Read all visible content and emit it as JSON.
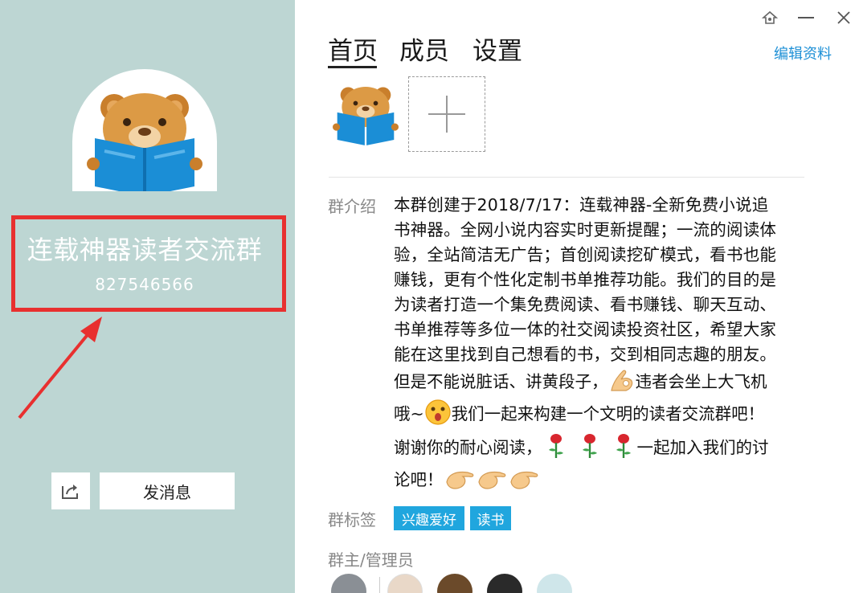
{
  "window_controls": {
    "skin_icon": "skin-icon",
    "minimize_icon": "minimize-icon",
    "close_icon": "close-icon"
  },
  "profile": {
    "group_name": "连载神器读者交流群",
    "group_id": "827546566",
    "avatar_icon": "bear-reading-book"
  },
  "actions": {
    "share_icon": "share-icon",
    "send_message_label": "发消息"
  },
  "tabs": [
    {
      "label": "首页",
      "active": true
    },
    {
      "label": "成员",
      "active": false
    },
    {
      "label": "设置",
      "active": false
    }
  ],
  "edit_profile_label": "编辑资料",
  "album": {
    "add_icon": "plus-icon"
  },
  "intro": {
    "label": "群介绍",
    "paragraph_lines": [
      "本群创建于2018/7/17：连载神器-全新免费小说追",
      "书神器。全网小说内容实时更新提醒；一流的阅读体",
      "验，全站简洁无广告；首创阅读挖矿模式，看书也能",
      "赚钱，更有个性化定制书单推荐功能。我们的目的是",
      "为读者打造一个集免费阅读、看书赚钱、聊天互动、",
      "书单推荐等多位一体的社交阅读投资社区，希望大家",
      "能在这里找到自己想看的书，交到相同志趣的朋友。"
    ],
    "line_1_before": "但是不能说脏话、讲黄段子，",
    "line_1_after": "违者会坐上大飞机",
    "line_2_before": "哦~",
    "line_2_after": "我们一起来构建一个文明的读者交流群吧！",
    "line_3_before": "谢谢你的耐心阅读，",
    "line_3_after": "一起加入我们的讨",
    "line_4": "论吧！"
  },
  "tags": {
    "label": "群标签",
    "items": [
      "兴趣爱好",
      "读书"
    ],
    "color": "#20a6de"
  },
  "admins": {
    "label": "群主/管理员"
  },
  "colors": {
    "left_panel_bg": "#bdd6d3",
    "highlight_border": "#e8302f",
    "link": "#1e90d6"
  }
}
